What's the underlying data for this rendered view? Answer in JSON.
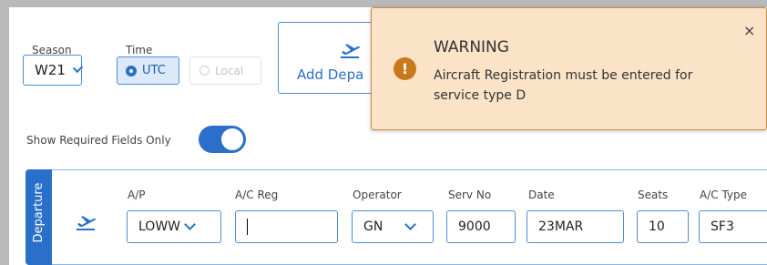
{
  "season": {
    "label": "Season",
    "value": "W21"
  },
  "time": {
    "label": "Time",
    "utc_label": "UTC",
    "local_label": "Local",
    "selected": "UTC"
  },
  "add_departure": {
    "label": "Add Depa"
  },
  "warning": {
    "title": "WARNING",
    "message": "Aircraft Registration must be entered for service type D",
    "close": "×"
  },
  "required_fields": {
    "label": "Show Required Fields Only",
    "enabled": true
  },
  "departure": {
    "tab_label": "Departure",
    "fields": {
      "ap": {
        "label": "A/P",
        "value": "LOWW"
      },
      "ac_reg": {
        "label": "A/C Reg",
        "value": ""
      },
      "operator": {
        "label": "Operator",
        "value": "GN"
      },
      "serv_no": {
        "label": "Serv No",
        "value": "9000"
      },
      "date": {
        "label": "Date",
        "value": "23MAR"
      },
      "seats": {
        "label": "Seats",
        "value": "10"
      },
      "ac_type": {
        "label": "A/C Type",
        "value": "SF3"
      }
    }
  },
  "colors": {
    "accent": "#2a6fc9",
    "warning_bg": "#fbe3c8",
    "warning_icon": "#c77a1a"
  }
}
